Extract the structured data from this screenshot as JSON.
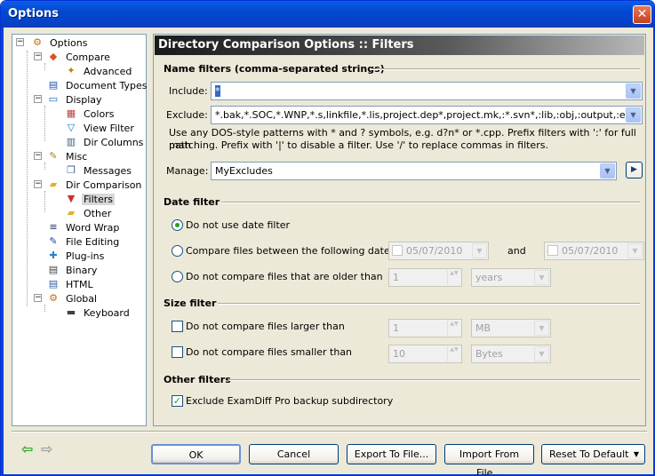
{
  "window": {
    "title": "Options",
    "close_glyph": "✕"
  },
  "tree": [
    {
      "label": "Options",
      "icon": "gear-icon",
      "glyph": "⚙"
    },
    {
      "label": "Compare",
      "icon": "compare-icon",
      "glyph": "◆"
    },
    {
      "label": "Advanced",
      "icon": "wand-icon",
      "glyph": "✦"
    },
    {
      "label": "Document Types",
      "icon": "doc-types-icon",
      "glyph": "▤"
    },
    {
      "label": "Display",
      "icon": "monitor-icon",
      "glyph": "▭"
    },
    {
      "label": "Colors",
      "icon": "colors-icon",
      "glyph": "▦"
    },
    {
      "label": "View Filter",
      "icon": "filter-icon",
      "glyph": "▽"
    },
    {
      "label": "Dir Columns",
      "icon": "columns-icon",
      "glyph": "▥"
    },
    {
      "label": "Misc",
      "icon": "wrench-icon",
      "glyph": "✎"
    },
    {
      "label": "Messages",
      "icon": "messages-icon",
      "glyph": "❐"
    },
    {
      "label": "Dir Comparison",
      "icon": "folder-icon",
      "glyph": "▰"
    },
    {
      "label": "Filters",
      "icon": "funnel-icon",
      "glyph": "▼"
    },
    {
      "label": "Other",
      "icon": "folder-other-icon",
      "glyph": "▰"
    },
    {
      "label": "Word Wrap",
      "icon": "word-wrap-icon",
      "glyph": "≡"
    },
    {
      "label": "File Editing",
      "icon": "edit-icon",
      "glyph": "✎"
    },
    {
      "label": "Plug-ins",
      "icon": "plugin-icon",
      "glyph": "✚"
    },
    {
      "label": "Binary",
      "icon": "binary-icon",
      "glyph": "▤"
    },
    {
      "label": "HTML",
      "icon": "html-icon",
      "glyph": "▤"
    },
    {
      "label": "Global",
      "icon": "global-icon",
      "glyph": "⚙"
    },
    {
      "label": "Keyboard",
      "icon": "keyboard-icon",
      "glyph": "▬"
    }
  ],
  "panel": {
    "header": "Directory Comparison Options :: Filters",
    "name_filters": {
      "section": "Name filters (comma-separated strings)",
      "include_label": "Include:",
      "include_value": "*",
      "exclude_label": "Exclude:",
      "exclude_value": "*.bak,*.SOC,*.WNP,*.s,linkfile,*.lis,project.dep*,project.mk,:*.svn*,:lib,:obj,:output,:emu,:ba",
      "hint_line1": "Use any DOS-style patterns with * and ? symbols, e.g. d?n* or *.cpp. Prefix filters with ':' for full path",
      "hint_line2": "matching. Prefix with '|' to disable a filter. Use '/' to replace commas in filters.",
      "manage_label": "Manage:",
      "manage_value": "MyExcludes",
      "arrow_glyph": "▶"
    },
    "date_filter": {
      "section": "Date filter",
      "opt1": "Do not use date filter",
      "opt2": "Compare files between the following dates:",
      "date_from": "05/07/2010",
      "and_label": "and",
      "date_to": "05/07/2010",
      "opt3": "Do not compare files that are older than",
      "older_value": "1",
      "older_unit": "years"
    },
    "size_filter": {
      "section": "Size filter",
      "opt1": "Do not compare files larger than",
      "larger_value": "1",
      "larger_unit": "MB",
      "opt2": "Do not compare files smaller than",
      "smaller_value": "10",
      "smaller_unit": "Bytes"
    },
    "other_filters": {
      "section": "Other filters",
      "opt1": "Exclude ExamDiff Pro backup subdirectory",
      "check_glyph": "✓"
    }
  },
  "buttons": {
    "ok": "OK",
    "cancel": "Cancel",
    "export": "Export To File...",
    "import": "Import From File...",
    "reset": "Reset To Default",
    "reset_arrow": "▼",
    "back_glyph": "⇦",
    "forward_glyph": "⇨"
  },
  "glyphs": {
    "dropdown": "▼",
    "spin": "▲▼",
    "minus": "−"
  },
  "colors": {
    "titlebar": "#0348d0",
    "accent_green": "#21a121",
    "header_dark": "#1a1a1a"
  }
}
